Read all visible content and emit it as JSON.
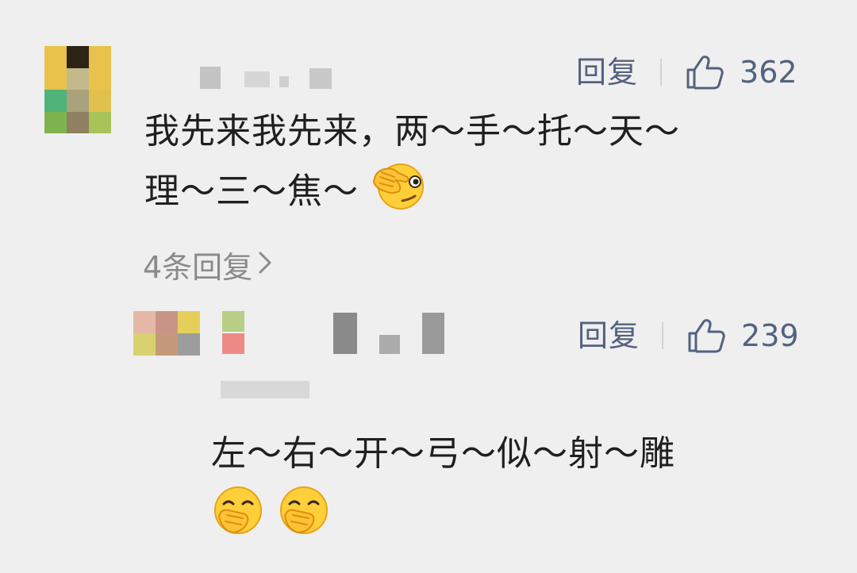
{
  "comments": [
    {
      "actions": {
        "reply_label": "回复",
        "likes": "362"
      },
      "text_line1": "我先来我先来，两～手～托～天～",
      "text_line2": "理～三～焦～",
      "emoji": "covering-eye-emoji",
      "replies_label": "4条回复"
    },
    {
      "actions": {
        "reply_label": "回复",
        "likes": "239"
      },
      "text_line1": "左～右～开～弓～似～射～雕",
      "emoji": "hand-over-mouth-emoji"
    }
  ],
  "colors": {
    "background": "#efefef",
    "action_text": "#53627f",
    "body_text": "#1f1f1f",
    "secondary_text": "#8a8a8a"
  },
  "icons": [
    "thumbs-up-icon",
    "chevron-right-icon"
  ]
}
